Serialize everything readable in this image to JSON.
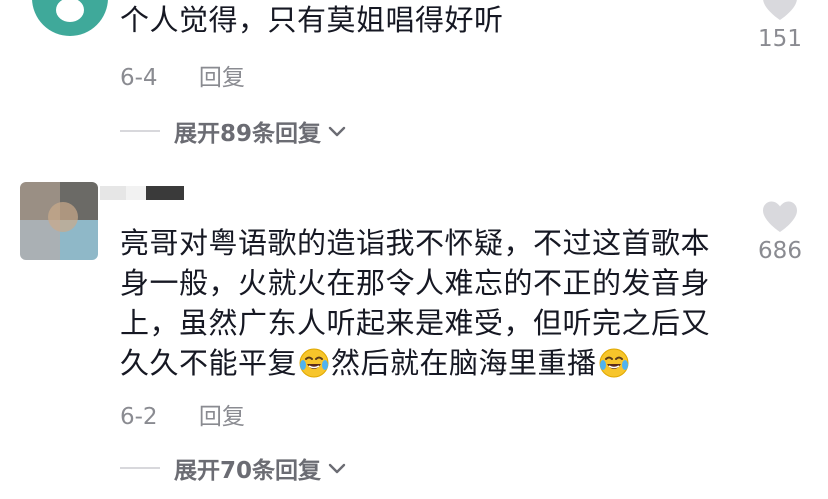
{
  "comments": [
    {
      "text": "个人觉得，只有莫姐唱得好听",
      "date": "6-4",
      "reply_label": "回复",
      "likes": "151",
      "expand_label": "展开89条回复"
    },
    {
      "text_part1": "亮哥对粤语歌的造诣我不怀疑，不过这首歌本身一般，火就火在那令人难忘的不正的发音身上，虽然广东人听起来是难受，但听完之后又久久不能平复",
      "text_part2": "然后就在脑海里重播",
      "emoji": "laughing-crying-emoji",
      "date": "6-2",
      "reply_label": "回复",
      "likes": "686",
      "expand_label": "展开70条回复"
    }
  ],
  "colors": {
    "text": "#161823",
    "meta": "#8a8b91",
    "expand": "#6b6c73",
    "heart": "#d9d9dd"
  }
}
